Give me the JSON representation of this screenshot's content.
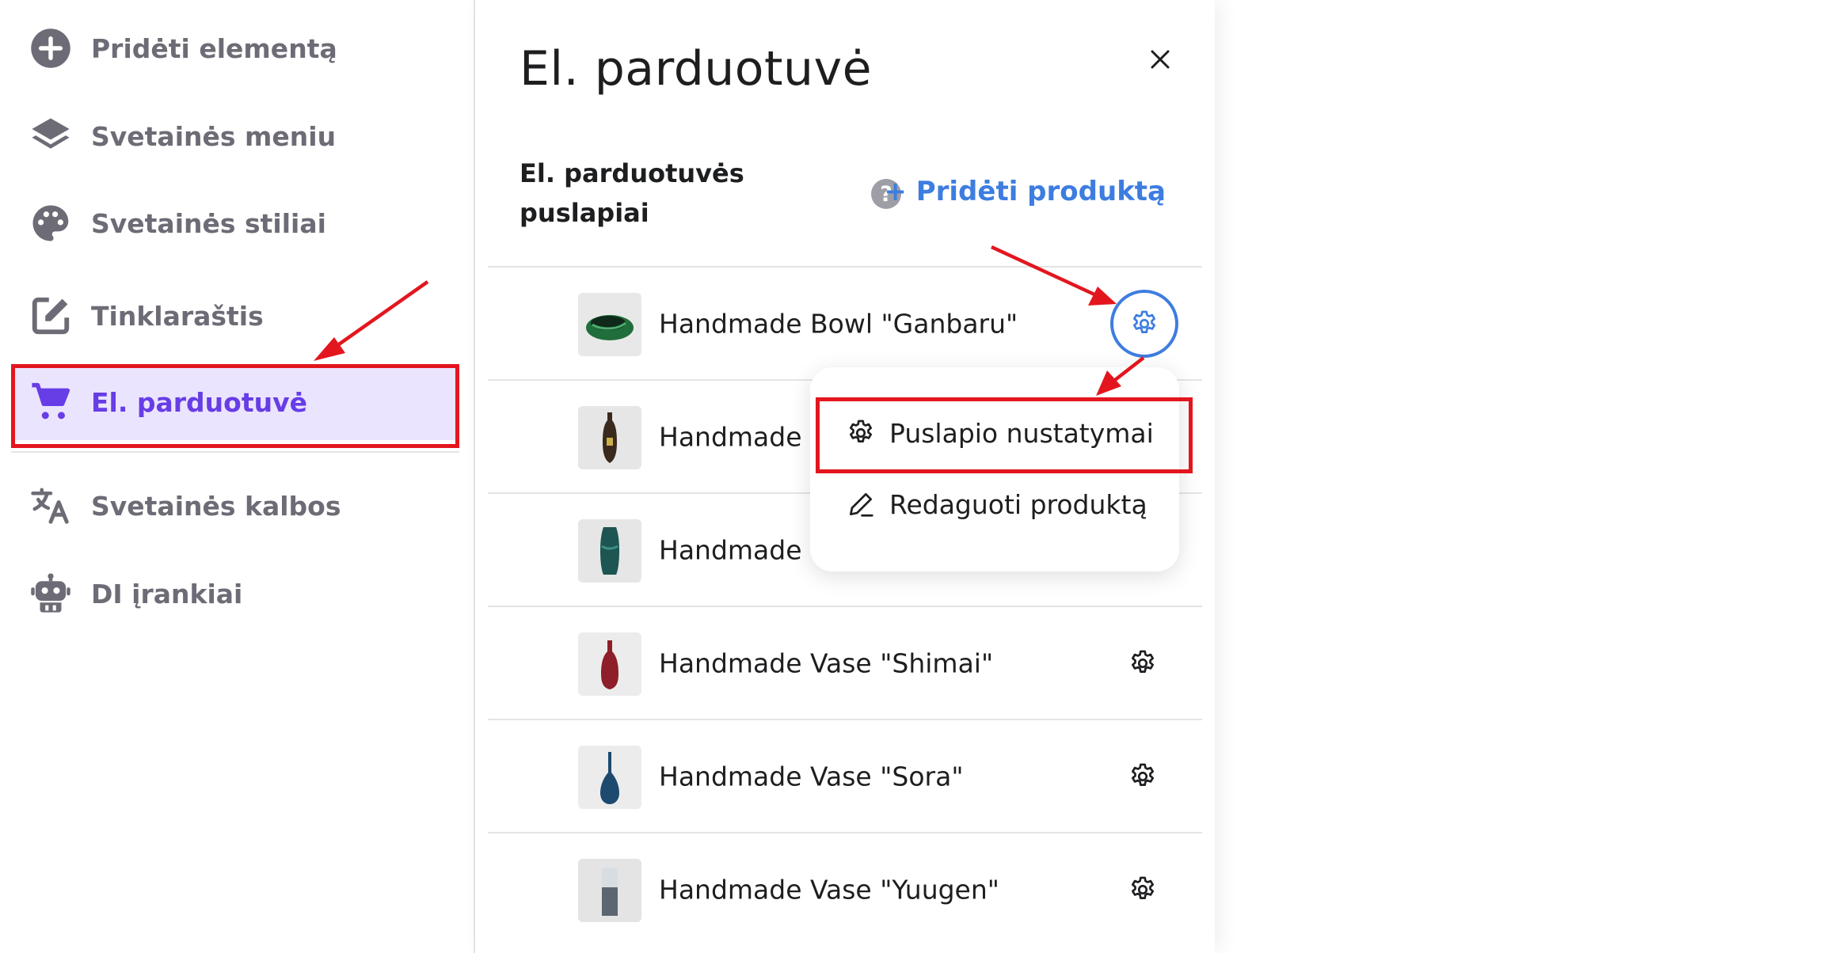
{
  "sidebar": {
    "items": [
      {
        "label": "Pridėti elementą",
        "icon": "plus-circle-icon",
        "active": false
      },
      {
        "label": "Svetainės meniu",
        "icon": "layers-icon",
        "active": false
      },
      {
        "label": "Svetainės stiliai",
        "icon": "palette-icon",
        "active": false
      },
      {
        "label": "Tinklaraštis",
        "icon": "edit-icon",
        "active": false
      },
      {
        "label": "El. parduotuvė",
        "icon": "cart-icon",
        "active": true
      },
      {
        "label": "Svetainės kalbos",
        "icon": "translate-icon",
        "active": false
      },
      {
        "label": "DI įrankiai",
        "icon": "robot-icon",
        "active": false
      }
    ]
  },
  "panel": {
    "title": "El. parduotuvė",
    "pages_heading": "El. parduotuvės puslapiai",
    "add_product": "+ Pridėti produktą",
    "products": [
      {
        "name": "Handmade Bowl \"Ganbaru\"",
        "thumb_color": "#1f6e3c"
      },
      {
        "name": "Handmade",
        "thumb_color": "#3a2a1e"
      },
      {
        "name": "Handmade V",
        "thumb_color": "#1d5552"
      },
      {
        "name": "Handmade Vase \"Shimai\"",
        "thumb_color": "#8e1e2a"
      },
      {
        "name": "Handmade Vase \"Sora\"",
        "thumb_color": "#1d4a6e"
      },
      {
        "name": "Handmade Vase \"Yuugen\"",
        "thumb_color": "#5d6670"
      }
    ]
  },
  "dropdown": {
    "items": [
      {
        "label": "Puslapio nustatymai",
        "icon": "gear-icon"
      },
      {
        "label": "Redaguoti produktą",
        "icon": "pencil-icon"
      }
    ]
  },
  "colors": {
    "accent": "#673de6",
    "active_bg": "#ebe4ff",
    "link": "#3d7de0",
    "annotation": "#e3161e"
  }
}
